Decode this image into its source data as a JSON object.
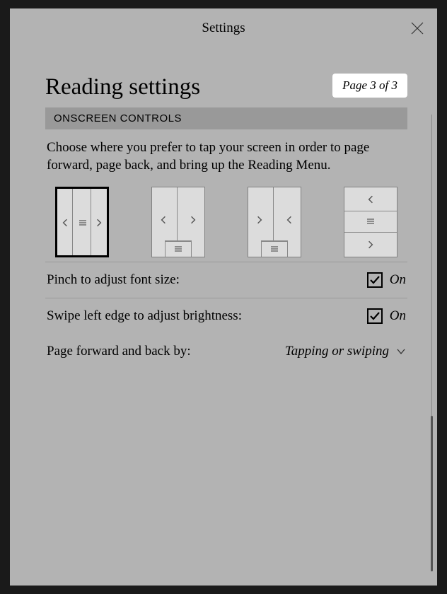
{
  "modal": {
    "title": "Settings"
  },
  "page": {
    "heading": "Reading settings",
    "badge": "Page 3 of 3"
  },
  "section": {
    "header": "ONSCREEN CONTROLS",
    "description": "Choose where you prefer to tap your screen in order to page forward, page back, and bring up the Reading Menu."
  },
  "settings": {
    "pinch": {
      "label": "Pinch to adjust font size:",
      "state": "On",
      "checked": true
    },
    "swipe": {
      "label": "Swipe left edge to adjust brightness:",
      "state": "On",
      "checked": true
    },
    "pagefwd": {
      "label": "Page forward and back by:",
      "value": "Tapping or swiping"
    }
  },
  "icons": {
    "chevron_left": "chevron-left-icon",
    "chevron_right": "chevron-right-icon",
    "menu": "menu-icon",
    "close": "close-icon"
  }
}
